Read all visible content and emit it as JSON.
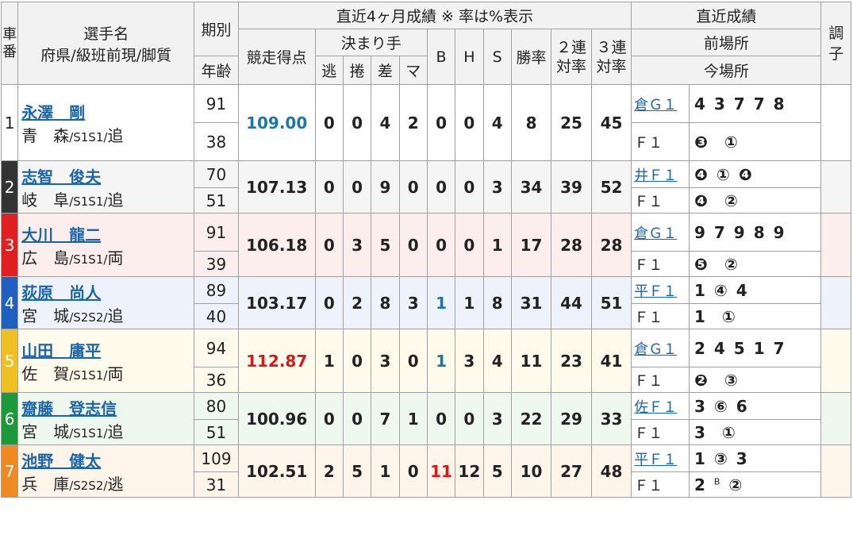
{
  "header": {
    "car_no": "車番",
    "name": "選手名",
    "pref_line": "府県/級班前現/脚質",
    "term": "期別",
    "age": "年齢",
    "points": "競走得点",
    "recent4": "直近4ヶ月成績 ※ 率は%表示",
    "kimarite": "決まり手",
    "nige": "逃",
    "makuri": "捲",
    "sashi": "差",
    "ma": "マ",
    "b": "B",
    "h": "H",
    "s": "S",
    "win_rate": "勝率",
    "rentai2": "２連対率",
    "rentai3": "３連対率",
    "recent_results": "直近成績",
    "prev_venue": "前場所",
    "this_venue": "今場所",
    "condition": "調子"
  },
  "riders": [
    {
      "car": "1",
      "name": "永澤　剛",
      "pref": "青　森",
      "cls": "/S1S1/",
      "style": "追",
      "term": "91",
      "age": "38",
      "points": "109.00",
      "pts_color": "blue",
      "nige": "0",
      "makuri": "0",
      "sashi": "4",
      "ma": "2",
      "b": "0",
      "b_color": "",
      "h": "0",
      "s": "4",
      "win": "8",
      "r2": "25",
      "r3": "45",
      "venue1": "倉Ｇ１",
      "res1": [
        "4",
        "3",
        "7",
        "7",
        "8"
      ],
      "venue2": "Ｆ１",
      "res2": [
        "❸",
        "①"
      ]
    },
    {
      "car": "2",
      "name": "志智　俊夫",
      "pref": "岐　阜",
      "cls": "/S1S1/",
      "style": "追",
      "term": "70",
      "age": "51",
      "points": "107.13",
      "pts_color": "",
      "nige": "0",
      "makuri": "0",
      "sashi": "9",
      "ma": "0",
      "b": "0",
      "b_color": "",
      "h": "0",
      "s": "3",
      "win": "34",
      "r2": "39",
      "r3": "52",
      "venue1": "井Ｆ１",
      "res1": [
        "❹",
        "①",
        "❹"
      ],
      "venue2": "Ｆ１",
      "res2": [
        "❹",
        "②"
      ]
    },
    {
      "car": "3",
      "name": "大川　龍二",
      "pref": "広　島",
      "cls": "/S1S1/",
      "style": "両",
      "term": "91",
      "age": "39",
      "points": "106.18",
      "pts_color": "",
      "nige": "0",
      "makuri": "3",
      "sashi": "5",
      "ma": "0",
      "b": "0",
      "b_color": "",
      "h": "0",
      "s": "1",
      "win": "17",
      "r2": "28",
      "r3": "28",
      "venue1": "倉Ｇ１",
      "res1": [
        "9",
        "7",
        "9",
        "8",
        "9"
      ],
      "venue2": "Ｆ１",
      "res2": [
        "❺",
        "②"
      ]
    },
    {
      "car": "4",
      "name": "荻原　尚人",
      "pref": "宮　城",
      "cls": "/S2S2/",
      "style": "追",
      "term": "89",
      "age": "40",
      "points": "103.17",
      "pts_color": "",
      "nige": "0",
      "makuri": "2",
      "sashi": "8",
      "ma": "3",
      "b": "1",
      "b_color": "blue",
      "h": "1",
      "s": "8",
      "win": "31",
      "r2": "44",
      "r3": "51",
      "venue1": "平Ｆ１",
      "res1": [
        "1",
        "④",
        "4"
      ],
      "venue2": "Ｆ１",
      "res2": [
        "1",
        "①"
      ]
    },
    {
      "car": "5",
      "name": "山田　庸平",
      "pref": "佐　賀",
      "cls": "/S1S1/",
      "style": "両",
      "term": "94",
      "age": "36",
      "points": "112.87",
      "pts_color": "red",
      "nige": "1",
      "makuri": "0",
      "sashi": "3",
      "ma": "0",
      "b": "1",
      "b_color": "blue",
      "h": "3",
      "s": "4",
      "win": "11",
      "r2": "23",
      "r3": "41",
      "venue1": "倉Ｇ１",
      "res1": [
        "2",
        "4",
        "5",
        "1",
        "7"
      ],
      "venue2": "Ｆ１",
      "res2": [
        "❷",
        "③"
      ]
    },
    {
      "car": "6",
      "name": "齋藤　登志信",
      "pref": "宮　城",
      "cls": "/S1S1/",
      "style": "追",
      "term": "80",
      "age": "51",
      "points": "100.96",
      "pts_color": "",
      "nige": "0",
      "makuri": "0",
      "sashi": "7",
      "ma": "1",
      "b": "0",
      "b_color": "",
      "h": "0",
      "s": "3",
      "win": "22",
      "r2": "29",
      "r3": "33",
      "venue1": "佐Ｆ１",
      "res1": [
        "3",
        "⑥",
        "6"
      ],
      "venue2": "Ｆ１",
      "res2": [
        "3",
        "①"
      ]
    },
    {
      "car": "7",
      "name": "池野　健太",
      "pref": "兵　庫",
      "cls": "/S2S2/",
      "style": "逃",
      "term": "109",
      "age": "31",
      "points": "102.51",
      "pts_color": "",
      "nige": "2",
      "makuri": "5",
      "sashi": "1",
      "ma": "0",
      "b": "11",
      "b_color": "red",
      "h": "12",
      "s": "5",
      "win": "10",
      "r2": "27",
      "r3": "48",
      "venue1": "平Ｆ１",
      "res1": [
        "1",
        "③",
        "3"
      ],
      "venue2": "Ｆ１",
      "res2": [
        "2",
        "②"
      ],
      "res2_sup": "B"
    }
  ],
  "colors": {
    "c1": "#ffffff",
    "c2": "#333333",
    "c3": "#e02020",
    "c4": "#1f5fc0",
    "c5": "#f0c020",
    "c6": "#1c9a3a",
    "c7": "#f08a20"
  }
}
